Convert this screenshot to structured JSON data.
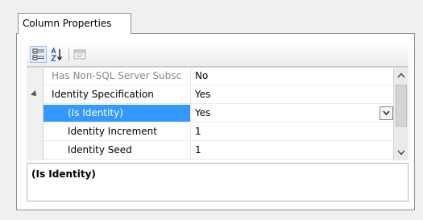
{
  "tab": {
    "label": "Column Properties"
  },
  "toolbar": {
    "buttons": [
      {
        "icon": "categorized-icon",
        "active": true
      },
      {
        "icon": "sort-alphabetical-icon"
      },
      {
        "icon": "property-pages-icon",
        "disabled": true
      }
    ]
  },
  "properties": [
    {
      "name": "Has Non-SQL Server Subsc",
      "value": "No",
      "muted": true
    },
    {
      "name": "Identity Specification",
      "value": "Yes",
      "expanded": true
    },
    {
      "name": "(Is Identity)",
      "value": "Yes",
      "selected": true,
      "dropdown": true
    },
    {
      "name": "Identity Increment",
      "value": "1"
    },
    {
      "name": "Identity Seed",
      "value": "1"
    }
  ],
  "description": {
    "title": "(Is Identity)",
    "text": ""
  },
  "colors": {
    "selection": "#3399ff",
    "muted_text": "#888888"
  }
}
